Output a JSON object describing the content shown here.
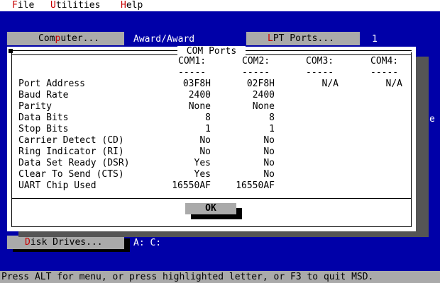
{
  "menubar": {
    "items": [
      {
        "hot": "F",
        "rest": "ile"
      },
      {
        "hot": "U",
        "rest": "tilities"
      },
      {
        "hot": "H",
        "rest": "elp"
      }
    ]
  },
  "background": {
    "computer_button_pre": "Com",
    "computer_button_hot": "p",
    "computer_button_post": "uter...",
    "computer_value": "Award/Award",
    "lpt_button_hot": "L",
    "lpt_button_post": "PT Ports...",
    "lpt_value": "1",
    "disk_button_hot": "D",
    "disk_button_post": "isk Drives...",
    "disk_value": "A: C:",
    "right_edge_text": "e"
  },
  "dialog": {
    "title": "COM Ports",
    "columns": [
      "COM1:",
      "COM2:",
      "COM3:",
      "COM4:"
    ],
    "separator": "-----",
    "rows": [
      {
        "label": "Port Address",
        "values": [
          "03F8H",
          "02F8H",
          "N/A",
          "N/A"
        ]
      },
      {
        "label": "Baud Rate",
        "values": [
          "2400",
          "2400",
          "",
          ""
        ]
      },
      {
        "label": "Parity",
        "values": [
          "None",
          "None",
          "",
          ""
        ]
      },
      {
        "label": "Data Bits",
        "values": [
          "8",
          "8",
          "",
          ""
        ]
      },
      {
        "label": "Stop Bits",
        "values": [
          "1",
          "1",
          "",
          ""
        ]
      },
      {
        "label": "Carrier Detect (CD)",
        "values": [
          "No",
          "No",
          "",
          ""
        ]
      },
      {
        "label": "Ring Indicator (RI)",
        "values": [
          "No",
          "No",
          "",
          ""
        ]
      },
      {
        "label": "Data Set Ready (DSR)",
        "values": [
          "Yes",
          "No",
          "",
          ""
        ]
      },
      {
        "label": "Clear To Send (CTS)",
        "values": [
          "Yes",
          "No",
          "",
          ""
        ]
      },
      {
        "label": "UART Chip Used",
        "values": [
          "16550AF",
          "16550AF",
          "",
          ""
        ]
      }
    ],
    "ok_label": "OK"
  },
  "statusbar": {
    "text": "Press ALT for menu, or press highlighted letter, or F3 to quit MSD."
  }
}
